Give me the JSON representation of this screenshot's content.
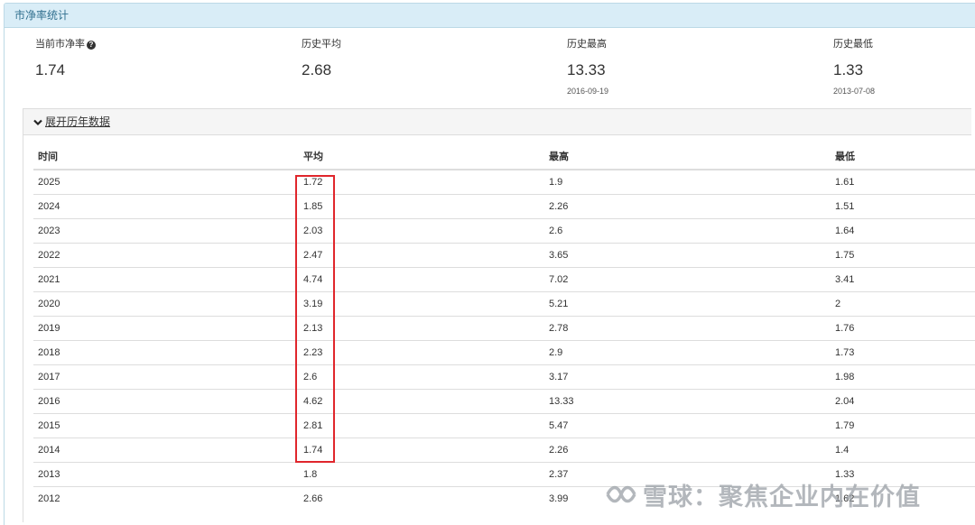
{
  "panel": {
    "title": "市净率统计"
  },
  "stats": [
    {
      "label": "当前市净率",
      "value": "1.74",
      "date": "",
      "has_help": true
    },
    {
      "label": "历史平均",
      "value": "2.68",
      "date": ""
    },
    {
      "label": "历史最高",
      "value": "13.33",
      "date": "2016-09-19"
    },
    {
      "label": "历史最低",
      "value": "1.33",
      "date": "2013-07-08"
    }
  ],
  "history": {
    "toggle_label": "展开历年数据",
    "columns": [
      "时间",
      "平均",
      "最高",
      "最低"
    ],
    "rows": [
      [
        "2025",
        "1.72",
        "1.9",
        "1.61"
      ],
      [
        "2024",
        "1.85",
        "2.26",
        "1.51"
      ],
      [
        "2023",
        "2.03",
        "2.6",
        "1.64"
      ],
      [
        "2022",
        "2.47",
        "3.65",
        "1.75"
      ],
      [
        "2021",
        "4.74",
        "7.02",
        "3.41"
      ],
      [
        "2020",
        "3.19",
        "5.21",
        "2"
      ],
      [
        "2019",
        "2.13",
        "2.78",
        "1.76"
      ],
      [
        "2018",
        "2.23",
        "2.9",
        "1.73"
      ],
      [
        "2017",
        "2.6",
        "3.17",
        "1.98"
      ],
      [
        "2016",
        "4.62",
        "13.33",
        "2.04"
      ],
      [
        "2015",
        "2.81",
        "5.47",
        "1.79"
      ],
      [
        "2014",
        "1.74",
        "2.26",
        "1.4"
      ],
      [
        "2013",
        "1.8",
        "2.37",
        "1.33"
      ],
      [
        "2012",
        "2.66",
        "3.99",
        "1.62"
      ]
    ]
  },
  "watermark": {
    "text": "雪球：聚焦企业内在价值"
  },
  "colors": {
    "header_bg": "#d9edf7",
    "header_text": "#31708f",
    "highlight": "#e0262c"
  }
}
